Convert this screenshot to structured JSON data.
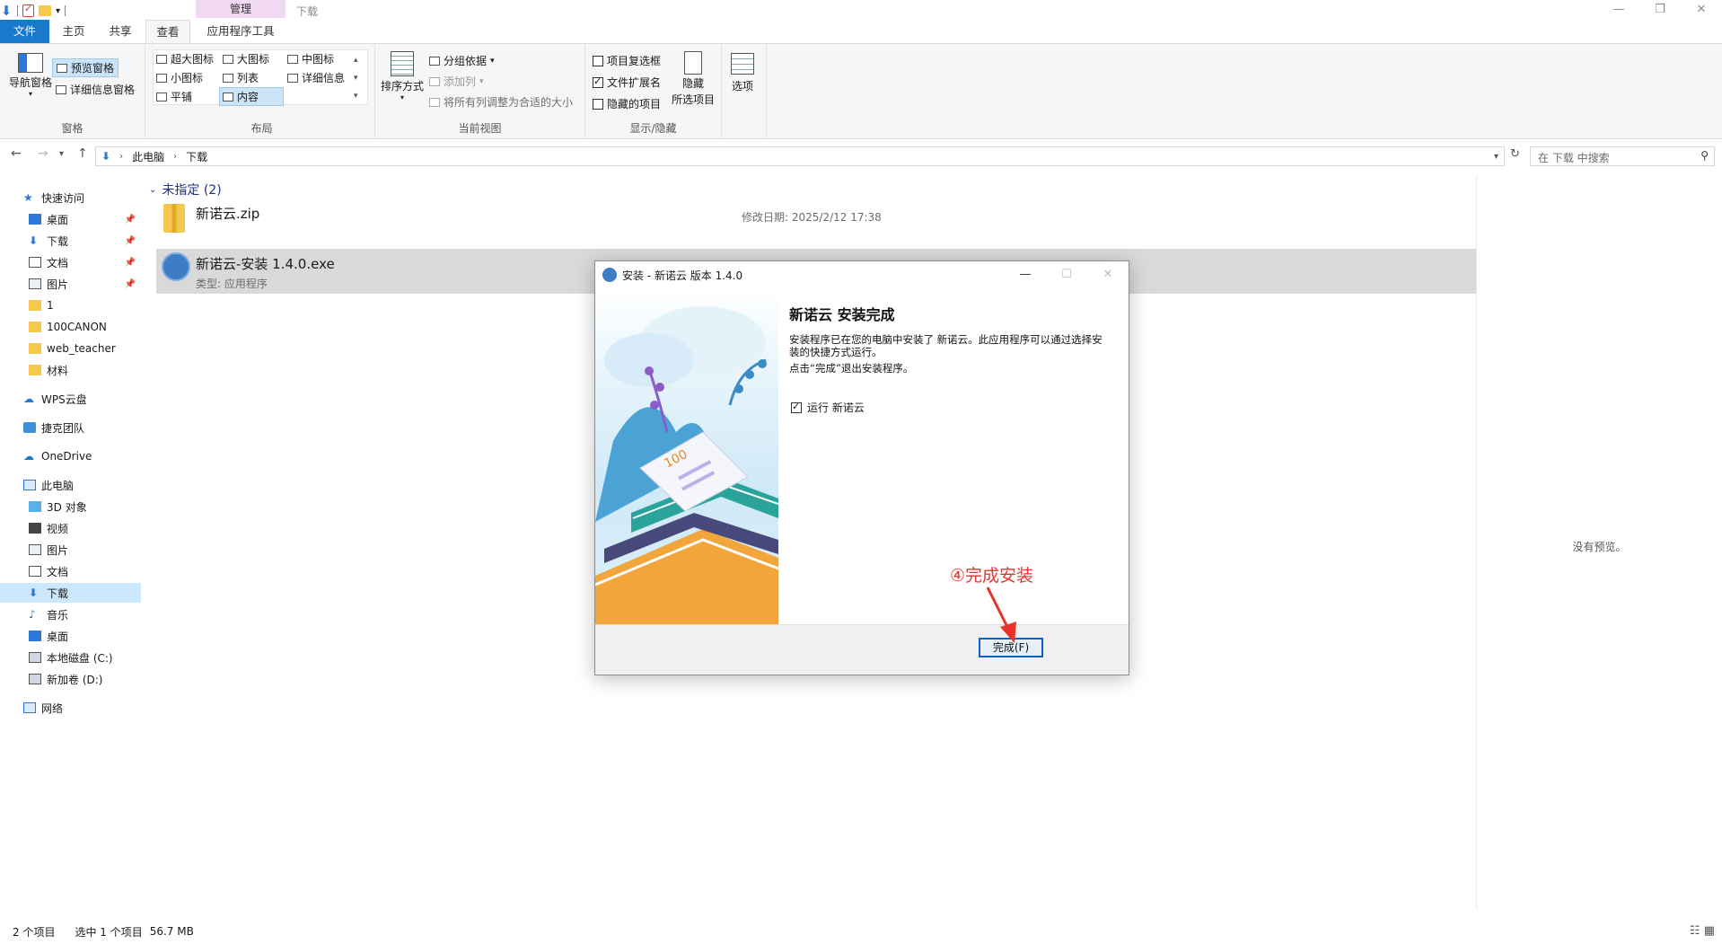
{
  "titlebar": {
    "context_tab": "管理",
    "title": "下载",
    "minimize": "—",
    "restore": "❐",
    "close": "✕"
  },
  "tabs": {
    "file": "文件",
    "home": "主页",
    "share": "共享",
    "view": "查看",
    "app_tools": "应用程序工具"
  },
  "ribbon": {
    "panes": {
      "label": "窗格",
      "nav_pane": "导航窗格",
      "preview_pane": "预览窗格",
      "details_pane": "详细信息窗格"
    },
    "layout": {
      "label": "布局",
      "items": [
        "超大图标",
        "大图标",
        "中图标",
        "小图标",
        "列表",
        "详细信息",
        "平铺",
        "内容"
      ]
    },
    "current_view": {
      "label": "当前视图",
      "sort_by": "排序方式",
      "group_by": "分组依据",
      "add_columns": "添加列",
      "fit_columns": "将所有列调整为合适的大小"
    },
    "show_hide": {
      "label": "显示/隐藏",
      "item_checkboxes": "项目复选框",
      "file_extensions": "文件扩展名",
      "hidden_items": "隐藏的项目",
      "hide_selected_line1": "隐藏",
      "hide_selected_line2": "所选项目",
      "item_checkboxes_checked": false,
      "file_extensions_checked": true,
      "hidden_items_checked": false
    },
    "options": "选项"
  },
  "address": {
    "crumb1": "此电脑",
    "crumb2": "下载",
    "search_placeholder": "在 下载 中搜索"
  },
  "sidebar": {
    "quick_access": "快速访问",
    "items_quick": [
      "桌面",
      "下载",
      "文档",
      "图片",
      "1",
      "100CANON",
      "web_teacher",
      "材料"
    ],
    "wps": "WPS云盘",
    "team": "捷克团队",
    "onedrive": "OneDrive",
    "this_pc": "此电脑",
    "items_pc": [
      "3D 对象",
      "视频",
      "图片",
      "文档",
      "下载",
      "音乐",
      "桌面",
      "本地磁盘 (C:)",
      "新加卷 (D:)"
    ],
    "network": "网络"
  },
  "content": {
    "group_header": "未指定 (2)",
    "files": [
      {
        "name": "新诺云.zip",
        "meta_label": "修改日期:",
        "meta_value": "2025/2/12 17:38"
      },
      {
        "name": "新诺云-安装 1.4.0.exe",
        "meta_label": "类型:",
        "meta_value": "应用程序"
      }
    ]
  },
  "preview": {
    "no_preview": "没有预览。"
  },
  "status": {
    "count": "2 个项目",
    "selected": "选中 1 个项目",
    "size": "56.7 MB"
  },
  "dialog": {
    "title": "安装 - 新诺云 版本 1.4.0",
    "heading": "新诺云 安装完成",
    "line1": "安装程序已在您的电脑中安装了 新诺云。此应用程序可以通过选择安装的快捷方式运行。",
    "line2": "点击“完成”退出安装程序。",
    "run_checkbox": "运行 新诺云",
    "run_checked": true,
    "finish_button": "完成(F)"
  },
  "annotation": {
    "text": "④完成安装",
    "color": "#e8322a"
  },
  "colors": {
    "accent": "#1979ca",
    "selection": "#cce8ff",
    "context_tab": "#f1d9f4"
  }
}
